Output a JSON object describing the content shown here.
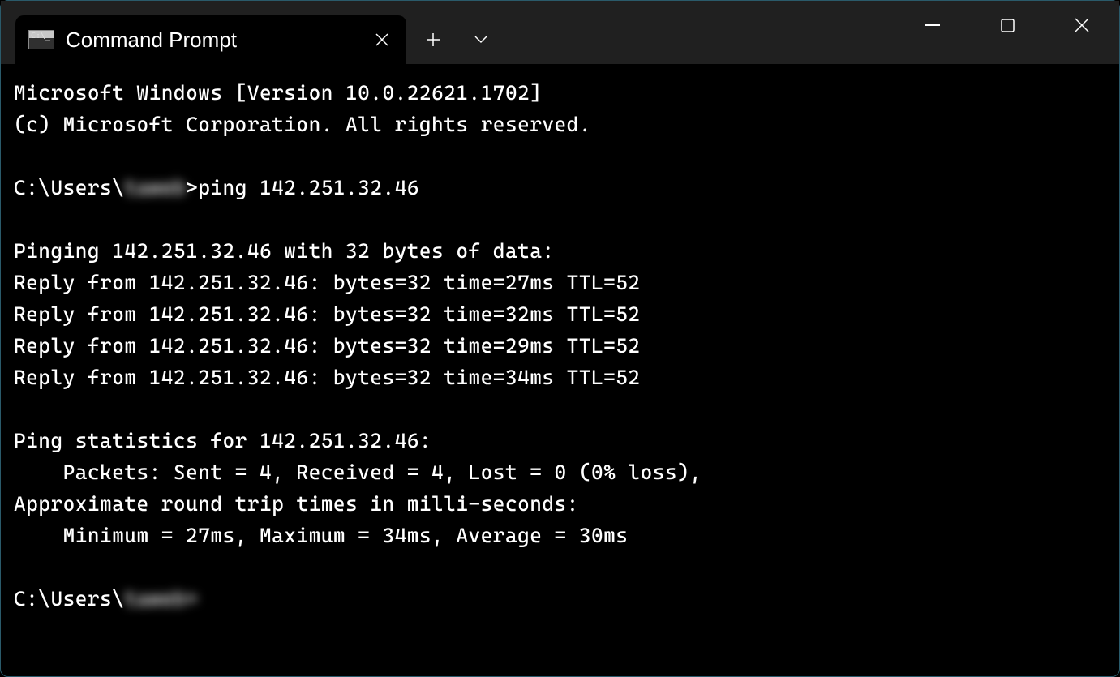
{
  "window": {
    "tab_title": "Command Prompt"
  },
  "terminal": {
    "banner_line1": "Microsoft Windows [Version 10.0.22621.1702]",
    "banner_line2": "(c) Microsoft Corporation. All rights reserved.",
    "prompt_prefix": "C:\\Users\\",
    "prompt_user_redacted": "taweb",
    "prompt_suffix": ">",
    "command": "ping 142.251.32.46",
    "ping_header": "Pinging 142.251.32.46 with 32 bytes of data:",
    "reply1": "Reply from 142.251.32.46: bytes=32 time=27ms TTL=52",
    "reply2": "Reply from 142.251.32.46: bytes=32 time=32ms TTL=52",
    "reply3": "Reply from 142.251.32.46: bytes=32 time=29ms TTL=52",
    "reply4": "Reply from 142.251.32.46: bytes=32 time=34ms TTL=52",
    "stats_header": "Ping statistics for 142.251.32.46:",
    "stats_packets": "    Packets: Sent = 4, Received = 4, Lost = 0 (0% loss),",
    "stats_rtt_header": "Approximate round trip times in milli-seconds:",
    "stats_rtt": "    Minimum = 27ms, Maximum = 34ms, Average = 30ms",
    "prompt2_prefix": "C:\\Users\\",
    "prompt2_user_redacted": "taweb>"
  }
}
